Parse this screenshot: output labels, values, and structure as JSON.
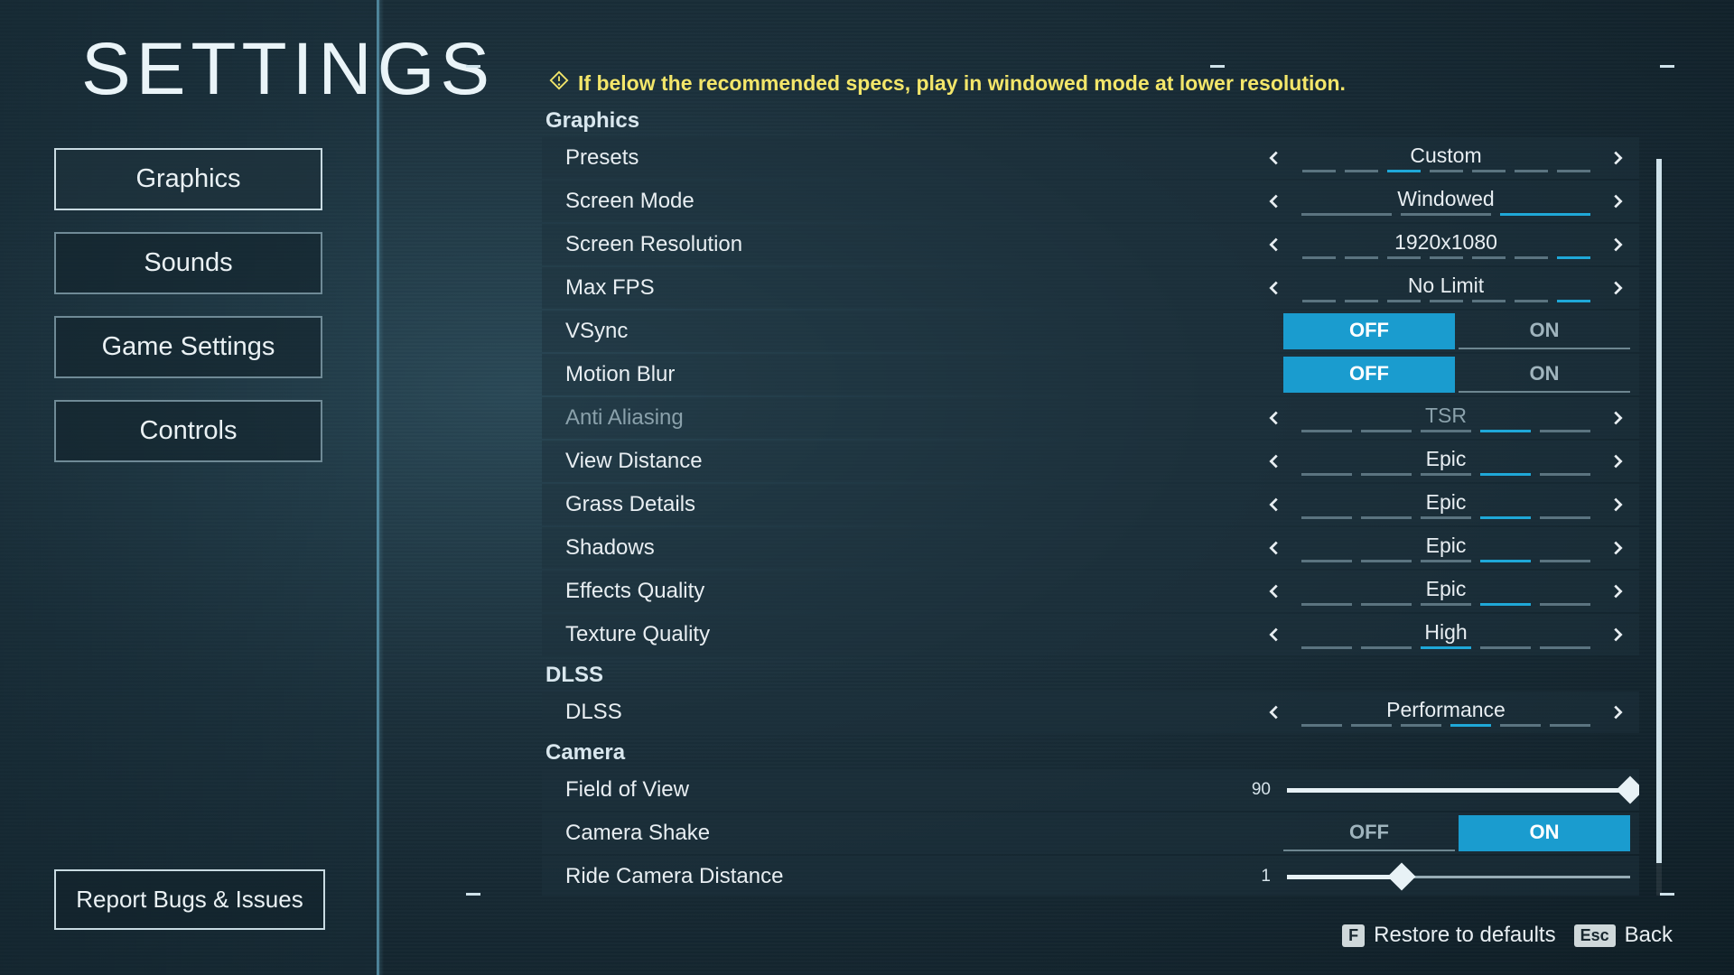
{
  "title": "SETTINGS",
  "nav": [
    {
      "label": "Graphics",
      "active": true
    },
    {
      "label": "Sounds",
      "active": false
    },
    {
      "label": "Game Settings",
      "active": false
    },
    {
      "label": "Controls",
      "active": false
    }
  ],
  "report_label": "Report Bugs & Issues",
  "tip": "If below the recommended specs, play in windowed mode at lower resolution.",
  "sections": {
    "graphics": {
      "title": "Graphics"
    },
    "dlss": {
      "title": "DLSS"
    },
    "camera": {
      "title": "Camera"
    }
  },
  "rows": {
    "presets": {
      "label": "Presets",
      "value": "Custom",
      "count": 7,
      "active": 2
    },
    "screenmode": {
      "label": "Screen Mode",
      "value": "Windowed",
      "count": 3,
      "active": 2
    },
    "resolution": {
      "label": "Screen Resolution",
      "value": "1920x1080",
      "count": 7,
      "active": 6
    },
    "maxfps": {
      "label": "Max FPS",
      "value": "No Limit",
      "count": 7,
      "active": 6
    },
    "vsync": {
      "label": "VSync",
      "off": "OFF",
      "on": "ON",
      "value": "OFF"
    },
    "motionblur": {
      "label": "Motion Blur",
      "off": "OFF",
      "on": "ON",
      "value": "OFF"
    },
    "aa": {
      "label": "Anti Aliasing",
      "value": "TSR",
      "count": 5,
      "active": 3
    },
    "viewdist": {
      "label": "View Distance",
      "value": "Epic",
      "count": 5,
      "active": 3
    },
    "grass": {
      "label": "Grass Details",
      "value": "Epic",
      "count": 5,
      "active": 3
    },
    "shadows": {
      "label": "Shadows",
      "value": "Epic",
      "count": 5,
      "active": 3
    },
    "effects": {
      "label": "Effects Quality",
      "value": "Epic",
      "count": 5,
      "active": 3
    },
    "texture": {
      "label": "Texture Quality",
      "value": "High",
      "count": 5,
      "active": 2
    },
    "dlss": {
      "label": "DLSS",
      "value": "Performance",
      "count": 6,
      "active": 3
    },
    "fov": {
      "label": "Field of View",
      "value": "90",
      "min": 60,
      "max": 90
    },
    "camshake": {
      "label": "Camera Shake",
      "off": "OFF",
      "on": "ON",
      "value": "ON"
    },
    "ridecam": {
      "label": "Ride Camera Distance",
      "value": "1",
      "min": 0,
      "max": 3
    }
  },
  "footer": {
    "restore_key": "F",
    "restore_label": "Restore to defaults",
    "back_key": "Esc",
    "back_label": "Back"
  }
}
